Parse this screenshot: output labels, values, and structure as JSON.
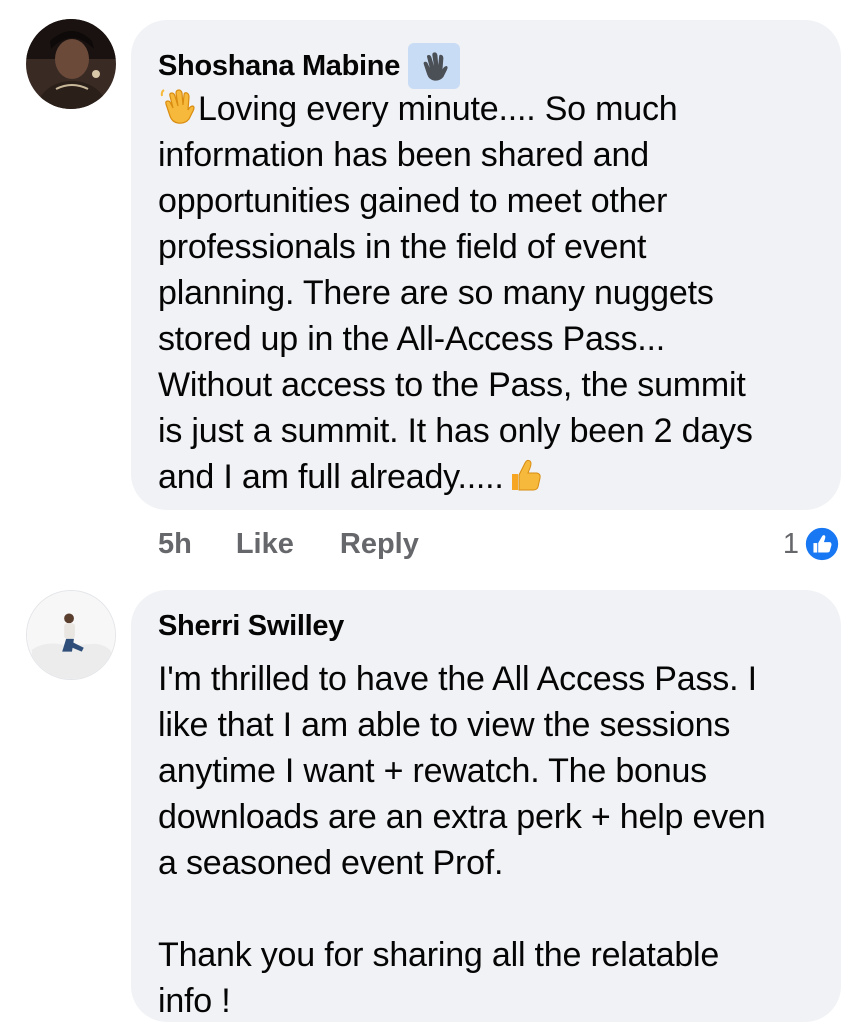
{
  "comments": [
    {
      "author": "Shoshana Mabine",
      "badge_icon": "waving-hand-icon",
      "leading_emoji": "waving-hand-emoji",
      "text": "Loving every minute.... So much\ninformation has been shared and\nopportunities gained to meet other\nprofessionals in the field of event\nplanning. There are so many nuggets\nstored up in the All-Access Pass...\nWithout access to the Pass, the summit\nis just a summit. It has only been 2 days\nand I am full already.....",
      "trailing_emoji": "thumbs-up-emoji",
      "time": "5h",
      "like_label": "Like",
      "reply_label": "Reply",
      "reaction_count": "1",
      "reaction_icon": "like-reaction-icon"
    },
    {
      "author": "Sherri Swilley",
      "text": "I'm thrilled to have the All Access Pass. I\nlike that I am able to view the sessions\nanytime I want + rewatch. The bonus\ndownloads are an extra perk + help even\na seasoned event Prof.\n\nThank you for sharing all the relatable\ninfo !"
    }
  ],
  "colors": {
    "bubble": "#f0f2f5",
    "badge": "#c9dcf5",
    "meta_text": "#65676b",
    "like_blue": "#1877f2"
  }
}
